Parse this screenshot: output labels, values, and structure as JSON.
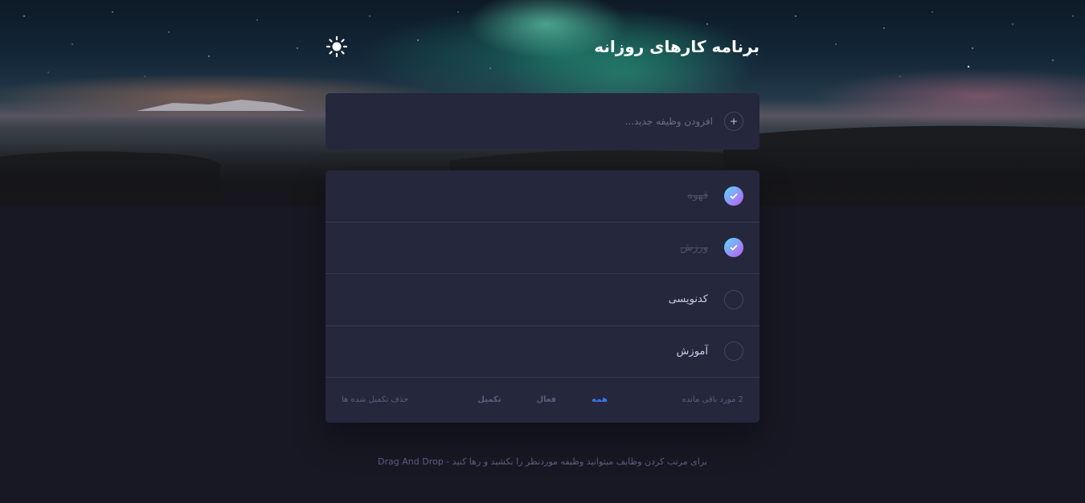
{
  "header": {
    "title": "برنامه کارهای روزانه",
    "theme_icon": "sun-icon"
  },
  "new_task": {
    "placeholder": "افزودن وظیفه جدید...",
    "add_icon": "plus-icon"
  },
  "todos": [
    {
      "label": "قهوه",
      "completed": true
    },
    {
      "label": "ورزش",
      "completed": true
    },
    {
      "label": "کدنویسی",
      "completed": false
    },
    {
      "label": "آموزش",
      "completed": false
    }
  ],
  "footer": {
    "items_left": "2 مورد باقی مانده",
    "filters": [
      {
        "label": "همه",
        "active": true
      },
      {
        "label": "فعال",
        "active": false
      },
      {
        "label": "تکمیل",
        "active": false
      }
    ],
    "clear_completed": "حذف تکمیل شده ها"
  },
  "hint": "برای مرتب کردن وظایف میتوانید وظیفه موردنظر را بکشید و رها کنید - Drag And Drop",
  "colors": {
    "background": "#181824",
    "card": "#25273c",
    "accent": "#3a7cfd",
    "check_gradient_start": "#57ddff",
    "check_gradient_end": "#c058f3"
  }
}
